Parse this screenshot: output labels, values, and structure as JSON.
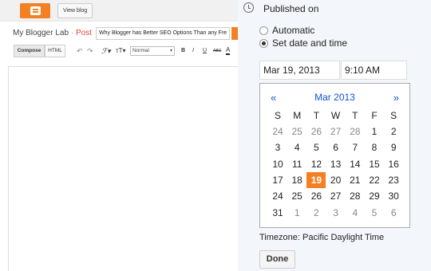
{
  "topbar": {
    "view_blog_label": "View blog",
    "logo": "blogger-logo-icon",
    "accent": "#f48024"
  },
  "post_header": {
    "blog_name": "My Blogger Lab",
    "separator": " · ",
    "post_label": "Post",
    "title_value": "Why Blogger has Better SEO Options Than any Fre"
  },
  "toolbar": {
    "compose_label": "Compose",
    "html_label": "HTML",
    "undo_icon": "undo-icon",
    "redo_icon": "redo-icon",
    "font_icon": "font-icon",
    "font_size_icon": "font-size-icon",
    "format_value": "Normal",
    "bold_label": "B",
    "italic_label": "I",
    "underline_label": "U",
    "strike_label": "ABC",
    "text_color_label": "A"
  },
  "schedule": {
    "heading": "Published on",
    "options": [
      {
        "label": "Automatic",
        "checked": false
      },
      {
        "label": "Set date and time",
        "checked": true
      }
    ],
    "date_value": "Mar 19, 2013",
    "time_value": "9:10 AM",
    "calendar": {
      "prev_label": "«",
      "next_label": "»",
      "month_label": "Mar 2013",
      "weekdays": [
        "S",
        "M",
        "T",
        "W",
        "T",
        "F",
        "S"
      ],
      "weeks": [
        [
          "24",
          "25",
          "26",
          "27",
          "28",
          "1",
          "2"
        ],
        [
          "3",
          "4",
          "5",
          "6",
          "7",
          "8",
          "9"
        ],
        [
          "10",
          "11",
          "12",
          "13",
          "14",
          "15",
          "16"
        ],
        [
          "17",
          "18",
          "19",
          "20",
          "21",
          "22",
          "23"
        ],
        [
          "24",
          "25",
          "26",
          "27",
          "28",
          "29",
          "30"
        ],
        [
          "31",
          "1",
          "2",
          "3",
          "4",
          "5",
          "6"
        ]
      ],
      "selected_day": "19"
    },
    "timezone_label": "Timezone: Pacific Daylight Time",
    "done_label": "Done"
  }
}
